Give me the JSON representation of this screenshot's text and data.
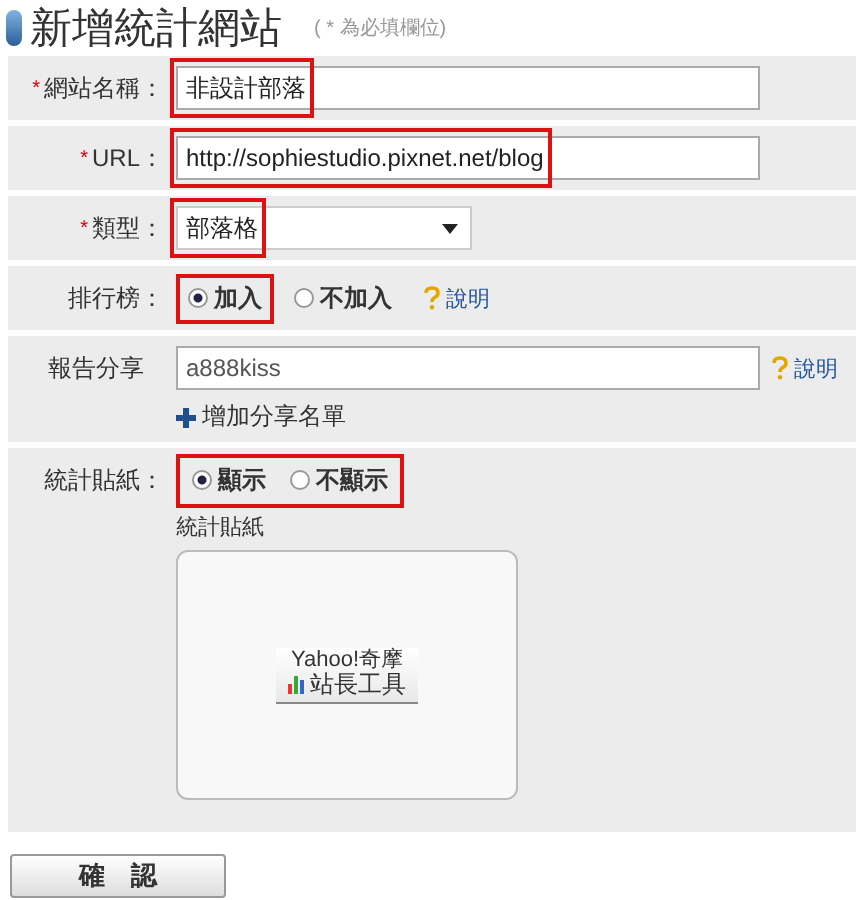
{
  "title": "新增統計網站",
  "title_note": "( * 為必填欄位)",
  "rows": [
    {
      "kind": "text",
      "mark": "*",
      "label": "網站名稱：",
      "value": "非設計部落",
      "highlighted": true
    },
    {
      "kind": "text",
      "mark": "*",
      "label": "URL：",
      "value": "http://sophiestudio.pixnet.net/blog",
      "highlighted": true
    },
    {
      "kind": "select",
      "mark": "*",
      "label": "類型：",
      "value": "部落格",
      "highlighted": true
    },
    {
      "kind": "radio",
      "label": "排行榜：",
      "options": [
        {
          "label": "加入",
          "selected": true,
          "highlighted": true
        },
        {
          "label": "不加入",
          "selected": false,
          "highlighted": false
        }
      ],
      "help": "說明"
    },
    {
      "kind": "share",
      "label": "報告分享",
      "value": "a888kiss",
      "help": "說明",
      "add_link": "增加分享名單"
    },
    {
      "kind": "sticker",
      "label": "統計貼紙：",
      "highlighted": true,
      "options": [
        {
          "label": "顯示",
          "selected": true
        },
        {
          "label": "不顯示",
          "selected": false
        }
      ],
      "preview_label": "統計貼紙",
      "badge_line_1": "Yahoo!奇摩",
      "badge_line_2": "站長工具"
    }
  ],
  "submit": "確　認"
}
